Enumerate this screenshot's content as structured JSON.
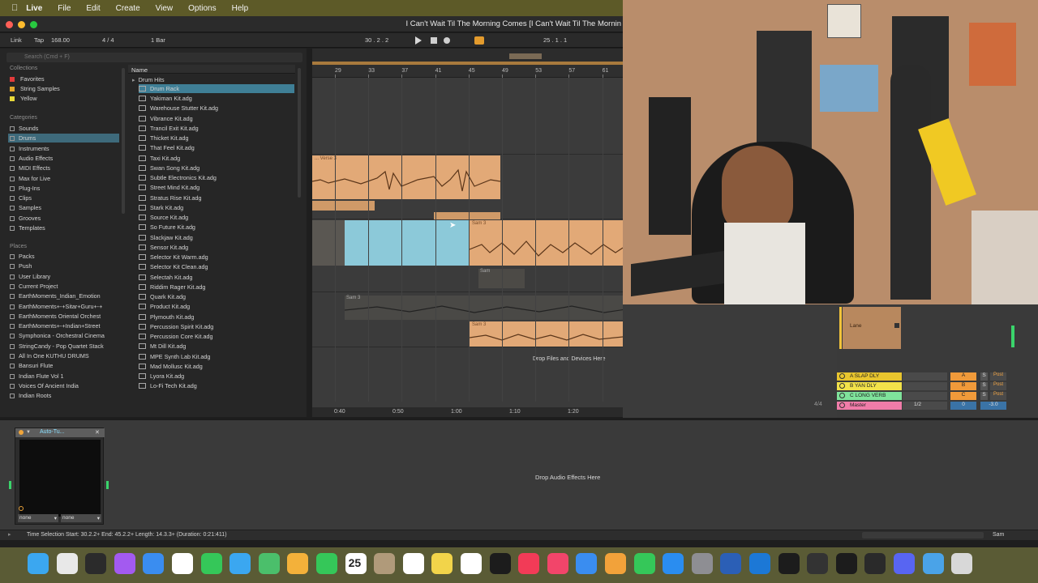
{
  "menubar": {
    "app": "Live",
    "items": [
      "File",
      "Edit",
      "Create",
      "View",
      "Options",
      "Help"
    ]
  },
  "window": {
    "title": "I Can't Wait Til The Morning Comes  [I Can't Wait Til The Mornin"
  },
  "controlbar": {
    "link": "Link",
    "tap": "Tap",
    "tempo": "168.00",
    "signature": "4 / 4",
    "quantize": "1 Bar",
    "position": "30 .  2 .  2",
    "loop_end": "25 .  1 .  1"
  },
  "browser": {
    "search_placeholder": "Search (Cmd + F)",
    "collections_header": "Collections",
    "collections": [
      {
        "label": "Favorites",
        "color": "#e23b3b"
      },
      {
        "label": "String Samples",
        "color": "#e2a72c"
      },
      {
        "label": "Yellow",
        "color": "#e8d93a"
      }
    ],
    "categories_header": "Categories",
    "categories": [
      "Sounds",
      "Drums",
      "Instruments",
      "Audio Effects",
      "MIDI Effects",
      "Max for Live",
      "Plug-Ins",
      "Clips",
      "Samples",
      "Grooves",
      "Templates"
    ],
    "selected_category": "Drums",
    "places_header": "Places",
    "places": [
      "Packs",
      "Push",
      "User Library",
      "Current Project",
      "EarthMoments_Indian_Emotion",
      "EarthMoments+-+Sitar+Guru+-+",
      "EarthMoments Oriental Orchest",
      "EarthMoments+-+Indian+Street",
      "Symphonica - Orchestral Cinema",
      "StringCandy - Pop Quartet Stack",
      "All In One KUTHU DRUMS",
      "Bansuri Flute",
      "Indian Flute Vol 1",
      "Voices Of Ancient India",
      "Indian Roots"
    ],
    "name_header": "Name",
    "folder": "Drum Hits",
    "selected_file": "Drum Rack",
    "files": [
      "Yakiman Kit.adg",
      "Warehouse Stutter Kit.adg",
      "Vibrance Kit.adg",
      "Trancil Exit Kit.adg",
      "Thicket Kit.adg",
      "That Feel Kit.adg",
      "Taxi Kit.adg",
      "Swan Song Kit.adg",
      "Subtle Electronics Kit.adg",
      "Street Mind Kit.adg",
      "Stratus Rise Kit.adg",
      "Stark Kit.adg",
      "Source Kit.adg",
      "So Future Kit.adg",
      "Slackjaw Kit.adg",
      "Sensor Kit.adg",
      "Selector Kit Warm.adg",
      "Selector Kit Clean.adg",
      "Selectah Kit.adg",
      "Riddim Rager Kit.adg",
      "Quark Kit.adg",
      "Product Kit.adg",
      "Plymouth Kit.adg",
      "Percussion Spirit Kit.adg",
      "Percussion Core Kit.adg",
      "Mt Dill Kit.adg",
      "MPE Synth Lab Kit.adg",
      "Mad Mollusc Kit.adg",
      "Lyora Kit.adg",
      "Lo-Fi Tech Kit.adg"
    ]
  },
  "arrangement": {
    "bars": [
      "29",
      "33",
      "37",
      "41",
      "45",
      "49",
      "53",
      "57",
      "61"
    ],
    "clips": [
      {
        "title": "... Verse 3"
      },
      {
        "title": "Sam 3"
      },
      {
        "title": "Sam"
      },
      {
        "title": "Sam 3"
      },
      {
        "title": "Sam 3"
      }
    ],
    "drop_files": "Drop Files and Devices Here",
    "time_marks": [
      "0:40",
      "0:50",
      "1:00",
      "1:10",
      "1:20",
      "1:30",
      "1:40",
      "1:50",
      "2:00"
    ]
  },
  "mixer": {
    "lane_label": "Lane",
    "returns": [
      {
        "name": "A SLAP DLY",
        "letter": "A",
        "color": "#e8c52e"
      },
      {
        "name": "B YAN DLY",
        "letter": "B",
        "color": "#f2e24a"
      },
      {
        "name": "C LONG VERB",
        "letter": "C",
        "color": "#7fe39b"
      },
      {
        "name": "Master",
        "letter": "",
        "color": "#f07ca9"
      }
    ],
    "solo": "S",
    "post": "Post",
    "master_ratio": "1/2",
    "master_vol": "0",
    "master_db": "-3.0",
    "fraction": "4/4"
  },
  "devices": {
    "plugin_title": "Auto-Tu...",
    "sel1": "none",
    "sel2": "none",
    "drop_effects": "Drop Audio Effects Here"
  },
  "status": {
    "selection": "Time Selection   Start: 30.2.2+   End: 45.2.2+   Length: 14.3.3+   (Duration: 0:21:411)",
    "track": "Sam"
  },
  "dock": {
    "calendar_day": "25",
    "apps": [
      "finder",
      "launchpad",
      "live",
      "podcast",
      "safari",
      "chrome",
      "messages",
      "mail",
      "maps",
      "photos",
      "facetime",
      "calendar",
      "contacts",
      "reminders",
      "notes",
      "freeform",
      "appletv",
      "music",
      "news",
      "keynote",
      "pages",
      "numbers",
      "appstore",
      "settings",
      "word",
      "xcode",
      "chatgpt",
      "logic",
      "cursor",
      "obs",
      "discord",
      "folder",
      "trash"
    ]
  }
}
